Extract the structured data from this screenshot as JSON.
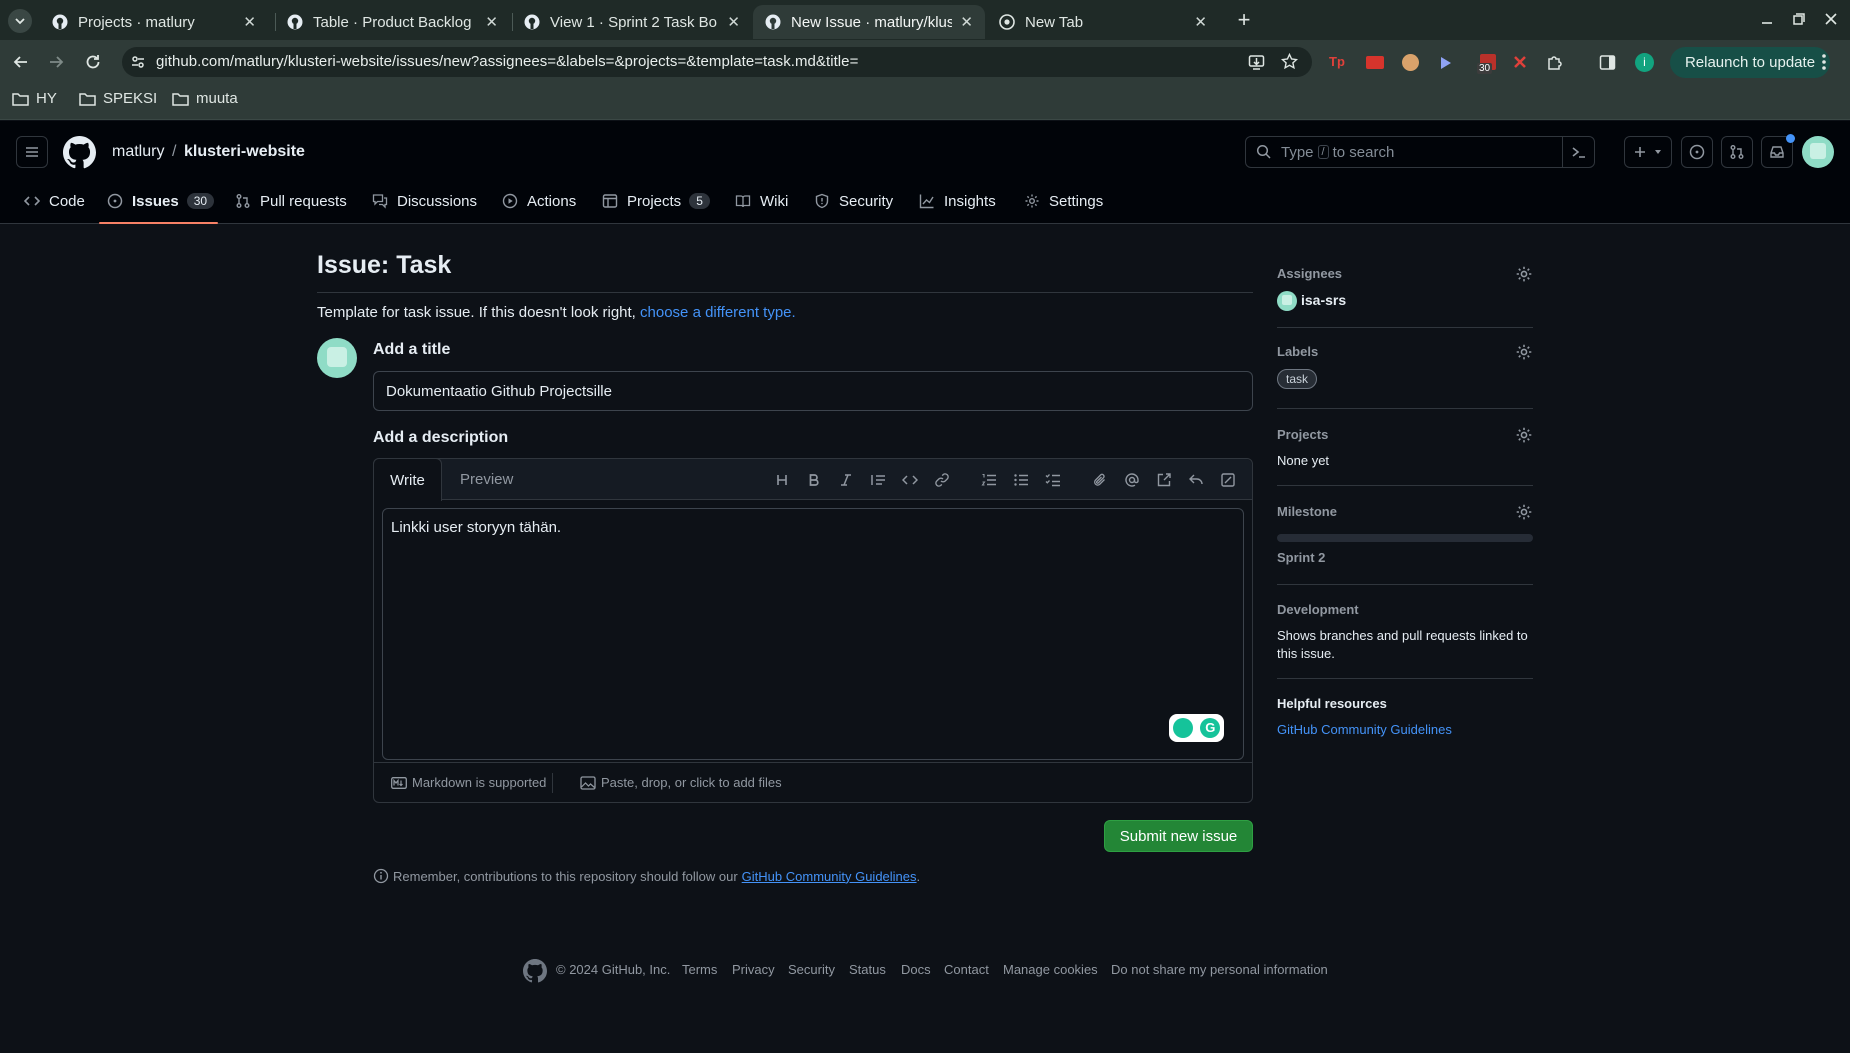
{
  "browser": {
    "tabs": [
      {
        "title": "Projects · matlury",
        "icon": "github-icon"
      },
      {
        "title": "Table · Product Backlog",
        "icon": "github-icon"
      },
      {
        "title": "View 1 · Sprint 2 Task Bo",
        "icon": "github-icon"
      },
      {
        "title": "New Issue · matlury/klus",
        "icon": "github-icon"
      },
      {
        "title": "New Tab",
        "icon": "chrome-icon"
      }
    ],
    "url": "github.com/matlury/klusteri-website/issues/new?assignees=&labels=&projects=&template=task.md&title=",
    "relaunch_label": "Relaunch to update",
    "extension_badge": "30",
    "bookmarks": [
      "HY",
      "SPEKSI",
      "muuta"
    ]
  },
  "header": {
    "owner": "matlury",
    "separator": "/",
    "repo": "klusteri-website",
    "search_prefix": "Type",
    "search_key": "/",
    "search_suffix": "to search"
  },
  "repo_nav": {
    "code": "Code",
    "issues": "Issues",
    "issues_count": "30",
    "pull_requests": "Pull requests",
    "discussions": "Discussions",
    "actions": "Actions",
    "projects": "Projects",
    "projects_count": "5",
    "wiki": "Wiki",
    "security": "Security",
    "insights": "Insights",
    "settings": "Settings"
  },
  "issue_form": {
    "heading": "Issue: Task",
    "template_note": "Template for task issue. If this doesn't look right,",
    "template_link": "choose a different type.",
    "title_label": "Add a title",
    "title_value": "Dokumentaatio Github Projectsille",
    "description_label": "Add a description",
    "tab_write": "Write",
    "tab_preview": "Preview",
    "body_value": "Linkki user storyyn tähän.",
    "markdown_note": "Markdown is supported",
    "files_note": "Paste, drop, or click to add files",
    "submit_label": "Submit new issue",
    "contrib_note": "Remember, contributions to this repository should follow our",
    "contrib_link": "GitHub Community Guidelines",
    "contrib_end": "."
  },
  "sidebar": {
    "assignees_label": "Assignees",
    "assignee": "isa-srs",
    "labels_label": "Labels",
    "label": "task",
    "projects_label": "Projects",
    "projects_value": "None yet",
    "milestone_label": "Milestone",
    "milestone_value": "Sprint 2",
    "development_label": "Development",
    "development_text_1": "Shows branches and pull requests linked to",
    "development_text_2": "this issue.",
    "helpful_label": "Helpful resources",
    "helpful_link": "GitHub Community Guidelines"
  },
  "footer": {
    "copyright": "© 2024 GitHub, Inc.",
    "links": [
      "Terms",
      "Privacy",
      "Security",
      "Status",
      "Docs",
      "Contact",
      "Manage cookies",
      "Do not share my personal information"
    ]
  },
  "colors": {
    "accent": "#4493f8",
    "submit": "#238636",
    "underline": "#f78166",
    "background": "#0d1117"
  }
}
